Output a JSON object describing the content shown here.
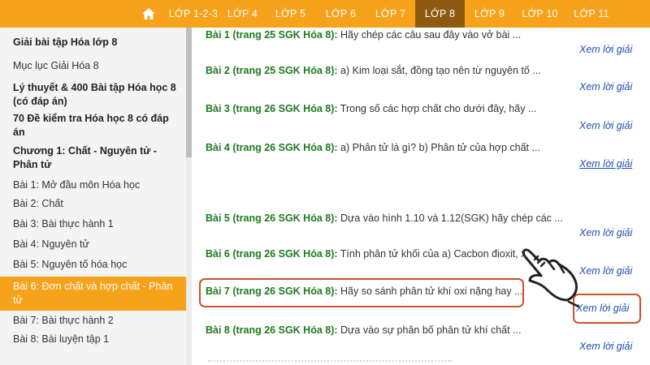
{
  "nav": {
    "home_icon": "home-icon",
    "items": [
      {
        "label": "LỚP 1-2-3",
        "active": false
      },
      {
        "label": "LỚP 4",
        "active": false
      },
      {
        "label": "LỚP 5",
        "active": false
      },
      {
        "label": "LỚP 6",
        "active": false
      },
      {
        "label": "LỚP 7",
        "active": false
      },
      {
        "label": "LỚP 8",
        "active": true
      },
      {
        "label": "LỚP 9",
        "active": false
      },
      {
        "label": "LỚP 10",
        "active": false
      },
      {
        "label": "LỚP 11",
        "active": false
      }
    ]
  },
  "sidebar": {
    "items": [
      {
        "label": "Giải bài tập Hóa lớp 8",
        "bold": true
      },
      {
        "label": "Mục lục Giải Hóa 8",
        "bold": false
      },
      {
        "label": "Lý thuyết & 400 Bài tập Hóa học 8 (có đáp án)",
        "bold": true
      },
      {
        "label": "70 Đề kiểm tra Hóa học 8 có đáp án",
        "bold": true
      },
      {
        "label": "Chương 1: Chất - Nguyên tử - Phân tử",
        "bold": true
      },
      {
        "label": "Bài 1: Mở đầu môn Hóa học",
        "bold": false
      },
      {
        "label": "Bài 2: Chất",
        "bold": false
      },
      {
        "label": "Bài 3: Bài thực hành 1",
        "bold": false
      },
      {
        "label": "Bài 4: Nguyên tử",
        "bold": false
      },
      {
        "label": "Bài 5: Nguyên tố hóa học",
        "bold": false
      },
      {
        "label": "Bài 6: Đơn chất và hợp chất - Phân tử",
        "bold": false,
        "active": true
      },
      {
        "label": "Bài 7: Bài thực hành 2",
        "bold": false
      },
      {
        "label": "Bài 8: Bài luyện tập 1",
        "bold": false
      }
    ]
  },
  "exercises": [
    {
      "label": "Bài 1 (trang 25 SGK Hóa 8):",
      "text": " Hãy chép các câu sau đây vào vở bài ...",
      "link": "Xem lời giải"
    },
    {
      "label": "Bài 2 (trang 25 SGK Hóa 8):",
      "text": " a) Kim loại sắt, đồng tạo nên từ nguyên tố ...",
      "link": "Xem lời giải"
    },
    {
      "label": "Bài 3 (trang 26 SGK Hóa 8):",
      "text": " Trong số các hợp chất cho dưới đây, hãy ...",
      "link": "Xem lời giải"
    },
    {
      "label": "Bài 4 (trang 26 SGK Hóa 8):",
      "text": " a) Phân tử là gì? b) Phân tử của hợp chất ...",
      "link": "Xem lời giải"
    },
    {
      "label": "Bài 5 (trang 26 SGK Hóa 8):",
      "text": " Dựa vào hình 1.10 và 1.12(SGK) hãy chép các ...",
      "link": "Xem lời giải"
    },
    {
      "label": "Bài 6 (trang 26 SGK Hóa 8):",
      "text": " Tính phân tử khối của a) Cacbon đioxit, xe",
      "link": "Xem lời giải"
    },
    {
      "label": "Bài 7 (trang 26 SGK Hóa 8):",
      "text": " Hãy so sánh phân tử khí oxi nặng hay ...",
      "link": "Xem lời giải"
    },
    {
      "label": "Bài 8 (trang 26 SGK Hóa 8):",
      "text": " Dựa vào sự phân bố phân tử khí chất ...",
      "link": "Xem lời giải"
    }
  ],
  "overlay": {
    "hand_icon": "pointing-hand-icon",
    "highlight_color": "#c9542a"
  },
  "colors": {
    "accent": "#f7a21b",
    "active_nav": "#8e5a10",
    "label_green": "#1e7a1e",
    "link_blue": "#1f4fb0"
  }
}
